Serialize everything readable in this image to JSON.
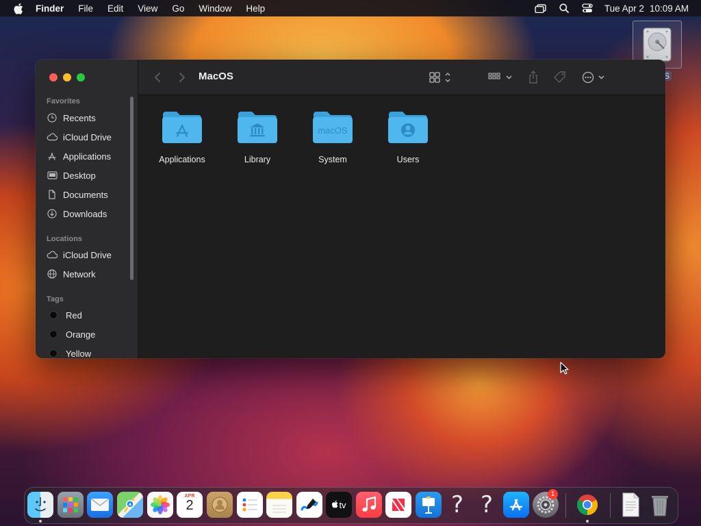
{
  "menubar": {
    "app_name": "Finder",
    "menus": [
      "File",
      "Edit",
      "View",
      "Go",
      "Window",
      "Help"
    ],
    "date": "Tue Apr 2",
    "time": "10:09 AM"
  },
  "desktop": {
    "disk_label": "S"
  },
  "finder": {
    "title": "MacOS",
    "sidebar": {
      "favorites_header": "Favorites",
      "favorites": [
        {
          "label": "Recents",
          "icon": "clock-icon"
        },
        {
          "label": "iCloud Drive",
          "icon": "cloud-icon"
        },
        {
          "label": "Applications",
          "icon": "applications-icon"
        },
        {
          "label": "Desktop",
          "icon": "desktop-icon"
        },
        {
          "label": "Documents",
          "icon": "document-icon"
        },
        {
          "label": "Downloads",
          "icon": "download-icon"
        }
      ],
      "locations_header": "Locations",
      "locations": [
        {
          "label": "iCloud Drive",
          "icon": "cloud-icon"
        },
        {
          "label": "Network",
          "icon": "network-icon"
        }
      ],
      "tags_header": "Tags",
      "tags": [
        {
          "label": "Red"
        },
        {
          "label": "Orange"
        },
        {
          "label": "Yellow"
        }
      ]
    },
    "items": [
      {
        "label": "Applications",
        "glyph": "applications"
      },
      {
        "label": "Library",
        "glyph": "library"
      },
      {
        "label": "System",
        "glyph": "macOS"
      },
      {
        "label": "Users",
        "glyph": "users"
      }
    ]
  },
  "dock": {
    "apps": [
      "Finder",
      "Launchpad",
      "Mail",
      "Maps",
      "Photos",
      "Calendar",
      "Contacts",
      "Reminders",
      "Notes",
      "Freeform",
      "TV",
      "Music",
      "News",
      "Keynote",
      "?",
      "?",
      "App Store",
      "System Settings",
      "Chrome",
      "Document",
      "Trash"
    ],
    "calendar": {
      "month": "APR",
      "day": "2"
    },
    "tv_label": "tv",
    "settings_badge": "1"
  },
  "colors": {
    "folder": "#4fb7ee",
    "folder_tab": "#3aa3dc",
    "accent": "#0a84ff"
  }
}
